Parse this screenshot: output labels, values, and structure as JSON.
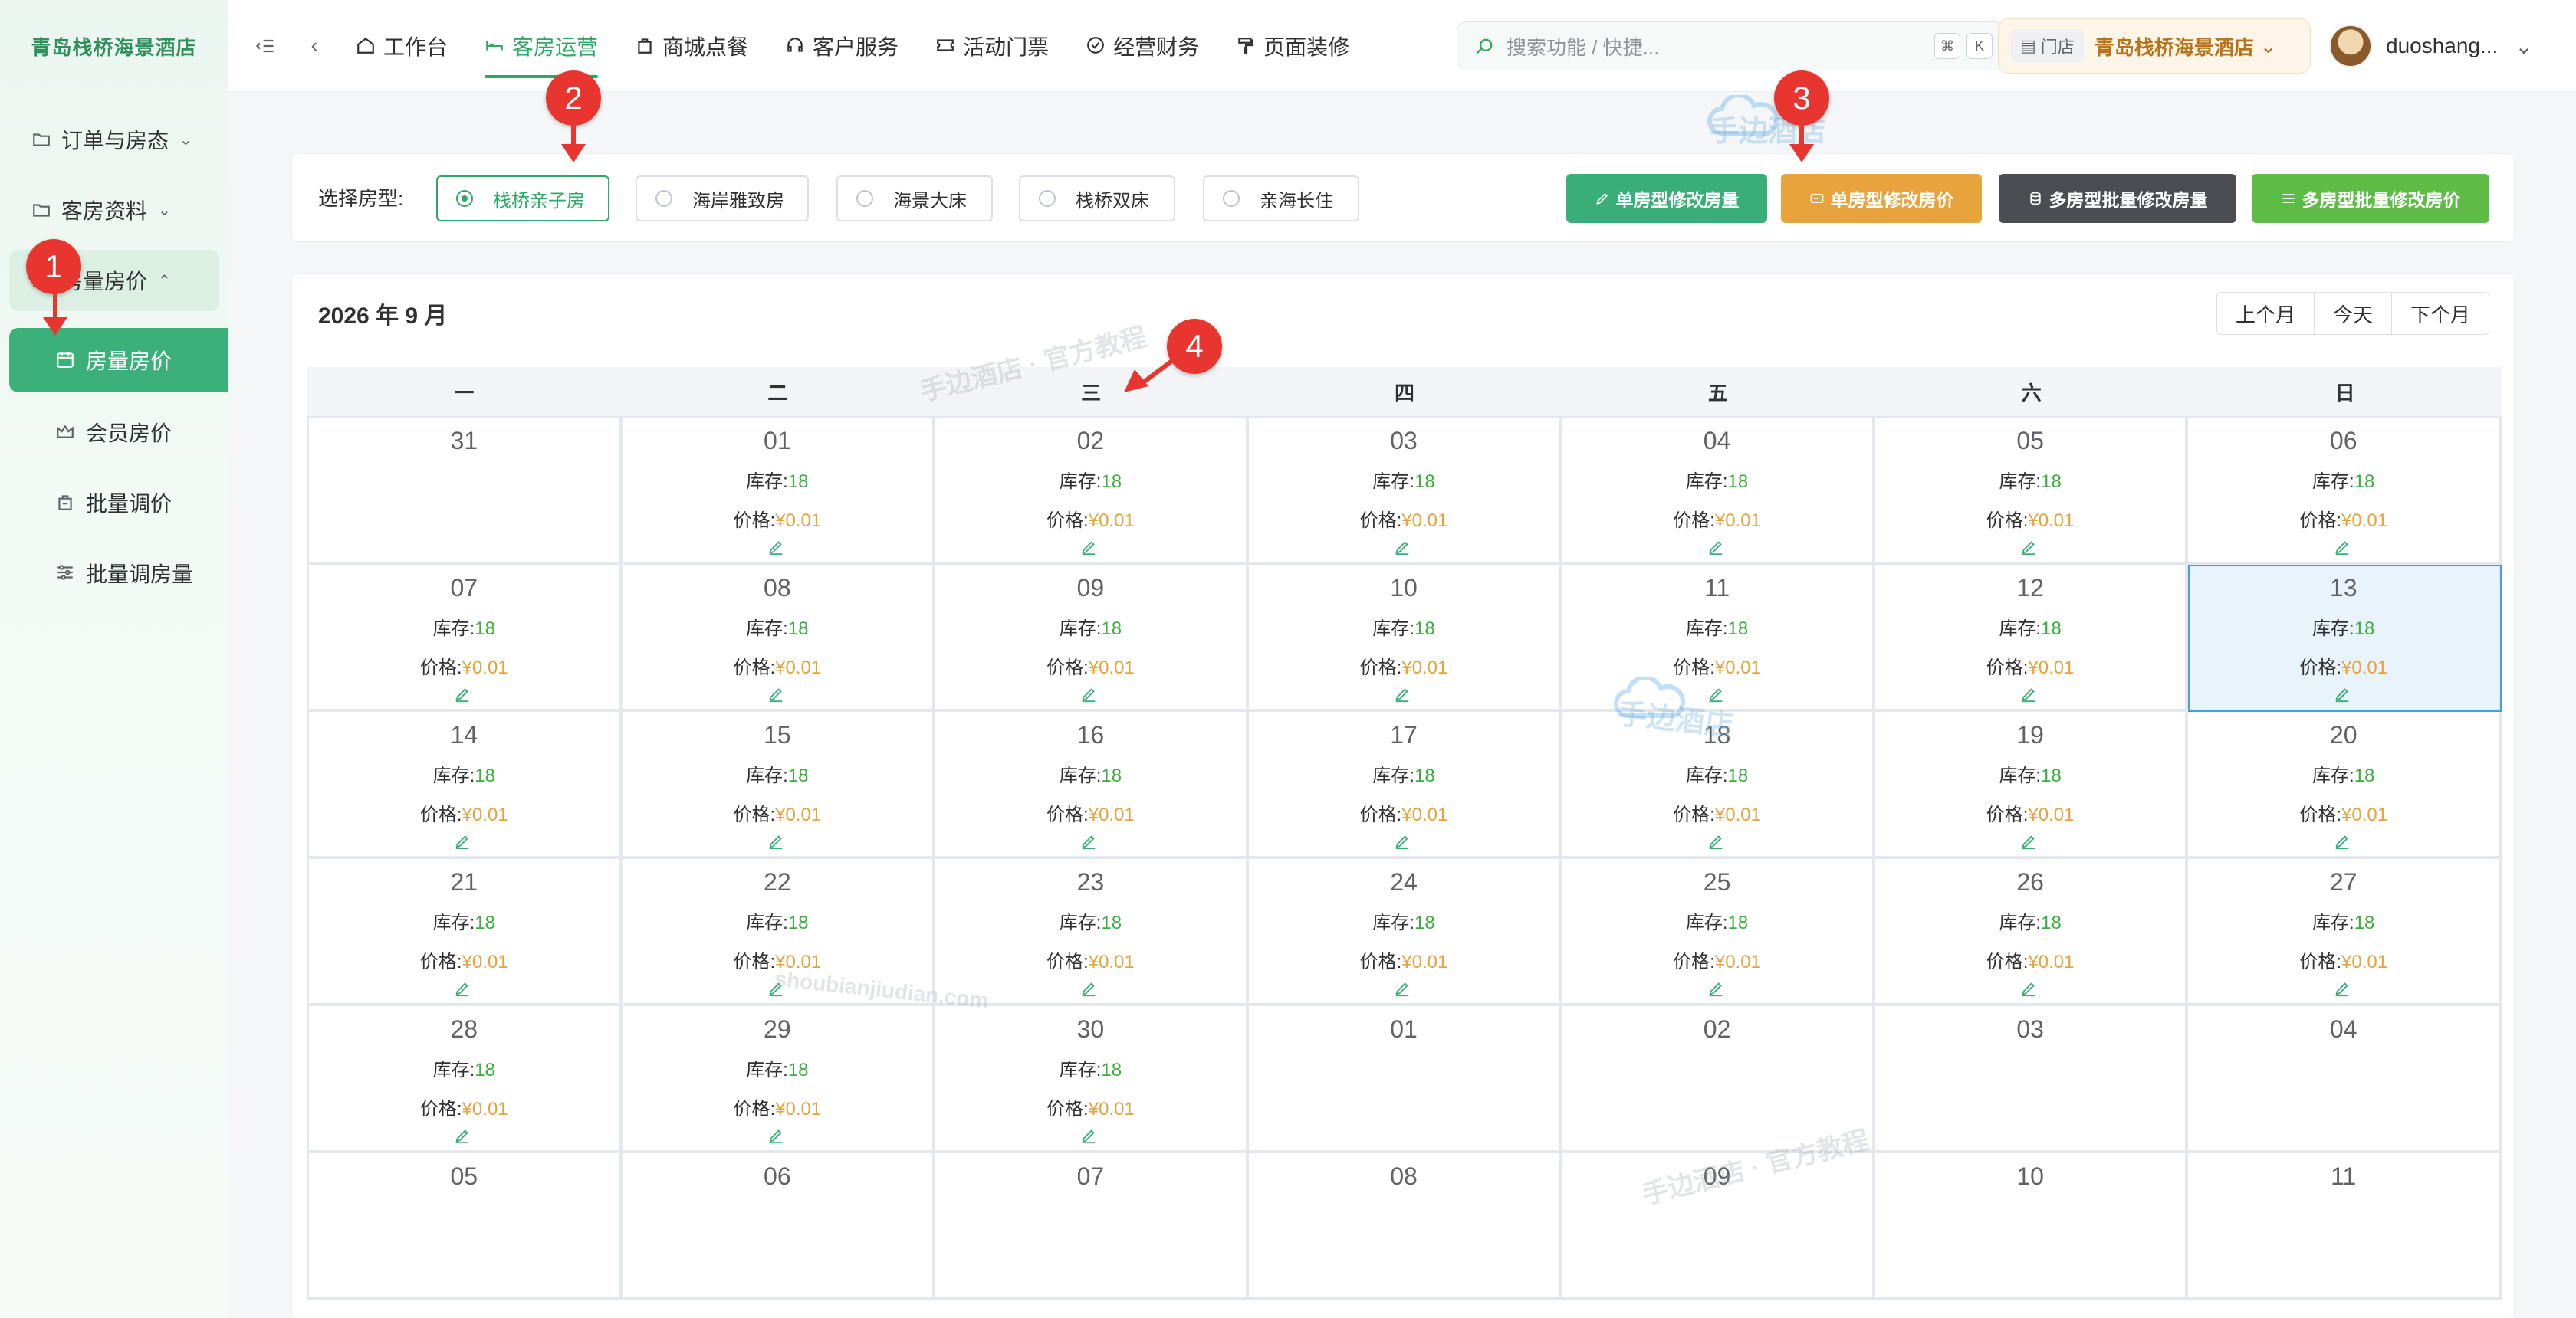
{
  "sidebar": {
    "brand": "青岛栈桥海景酒店",
    "menus": [
      {
        "label": "订单与房态",
        "icon": "folder-icon"
      },
      {
        "label": "客房资料",
        "icon": "folder-icon"
      },
      {
        "label": "房量房价",
        "icon": "folder-icon"
      }
    ],
    "submenu": [
      {
        "label": "房量房价",
        "icon": "calendar-icon",
        "active": true
      },
      {
        "label": "会员房价",
        "icon": "crown-icon"
      },
      {
        "label": "批量调价",
        "icon": "bag-icon"
      },
      {
        "label": "批量调房量",
        "icon": "sliders-icon"
      }
    ]
  },
  "header": {
    "nav": [
      {
        "label": "工作台",
        "icon": "home-icon"
      },
      {
        "label": "客房运营",
        "icon": "bed-icon",
        "active": true
      },
      {
        "label": "商城点餐",
        "icon": "shopping-bag-icon"
      },
      {
        "label": "客户服务",
        "icon": "headset-icon"
      },
      {
        "label": "活动门票",
        "icon": "ticket-icon"
      },
      {
        "label": "经营财务",
        "icon": "check-circle-icon"
      },
      {
        "label": "页面装修",
        "icon": "paint-roller-icon"
      }
    ],
    "search_placeholder": "搜索功能 / 快捷...",
    "shortcut_keys": [
      "⌘",
      "K"
    ],
    "store_tag": "门店",
    "store_name": "青岛栈桥海景酒店",
    "username": "duoshang..."
  },
  "room_types": {
    "label": "选择房型:",
    "options": [
      "栈桥亲子房",
      "海岸雅致房",
      "海景大床",
      "栈桥双床",
      "亲海长住"
    ],
    "selected_index": 0
  },
  "actions": [
    {
      "label": "单房型修改房量",
      "color": "#3aae79",
      "icon": "pencil-icon"
    },
    {
      "label": "单房型修改房价",
      "color": "#e8a33c",
      "icon": "price-tag-icon"
    },
    {
      "label": "多房型批量修改房量",
      "color": "#4a4d52",
      "icon": "database-icon"
    },
    {
      "label": "多房型批量修改房价",
      "color": "#5dbb46",
      "icon": "sliders-icon"
    }
  ],
  "calendar": {
    "title": "2026 年 9 月",
    "nav": [
      "上个月",
      "今天",
      "下个月"
    ],
    "weekdays": [
      "一",
      "二",
      "三",
      "四",
      "五",
      "六",
      "日"
    ],
    "stock_label": "库存:",
    "price_label": "价格:",
    "stock_value": "18",
    "price_value": "¥0.01",
    "today": "13",
    "days": [
      {
        "d": "31",
        "info": false
      },
      {
        "d": "01",
        "info": true
      },
      {
        "d": "02",
        "info": true
      },
      {
        "d": "03",
        "info": true
      },
      {
        "d": "04",
        "info": true
      },
      {
        "d": "05",
        "info": true
      },
      {
        "d": "06",
        "info": true
      },
      {
        "d": "07",
        "info": true
      },
      {
        "d": "08",
        "info": true
      },
      {
        "d": "09",
        "info": true
      },
      {
        "d": "10",
        "info": true
      },
      {
        "d": "11",
        "info": true
      },
      {
        "d": "12",
        "info": true
      },
      {
        "d": "13",
        "info": true
      },
      {
        "d": "14",
        "info": true
      },
      {
        "d": "15",
        "info": true
      },
      {
        "d": "16",
        "info": true
      },
      {
        "d": "17",
        "info": true
      },
      {
        "d": "18",
        "info": true
      },
      {
        "d": "19",
        "info": true
      },
      {
        "d": "20",
        "info": true
      },
      {
        "d": "21",
        "info": true
      },
      {
        "d": "22",
        "info": true
      },
      {
        "d": "23",
        "info": true
      },
      {
        "d": "24",
        "info": true
      },
      {
        "d": "25",
        "info": true
      },
      {
        "d": "26",
        "info": true
      },
      {
        "d": "27",
        "info": true
      },
      {
        "d": "28",
        "info": true
      },
      {
        "d": "29",
        "info": true
      },
      {
        "d": "30",
        "info": true
      },
      {
        "d": "01",
        "info": false
      },
      {
        "d": "02",
        "info": false
      },
      {
        "d": "03",
        "info": false
      },
      {
        "d": "04",
        "info": false
      },
      {
        "d": "05",
        "info": false
      },
      {
        "d": "06",
        "info": false
      },
      {
        "d": "07",
        "info": false
      },
      {
        "d": "08",
        "info": false
      },
      {
        "d": "09",
        "info": false
      },
      {
        "d": "10",
        "info": false
      },
      {
        "d": "11",
        "info": false
      }
    ]
  },
  "annotations": [
    "1",
    "2",
    "3",
    "4"
  ],
  "watermarks": [
    "手边酒店 · 官方教程",
    "手边酒店",
    "shoubianjiudian.com"
  ]
}
